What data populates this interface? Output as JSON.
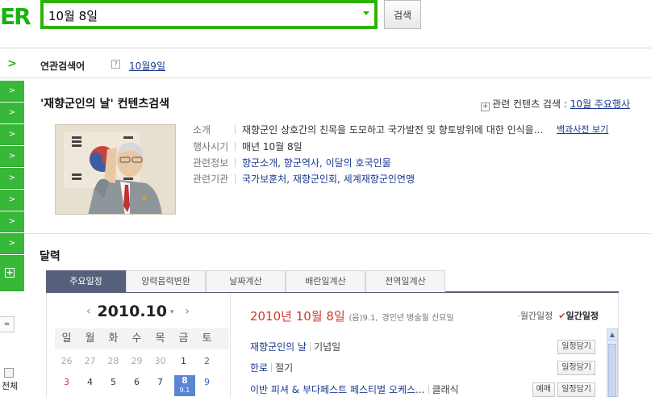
{
  "header": {
    "logo_text": "ER",
    "search_value": "10월 8일",
    "search_button": "검색"
  },
  "sidebar": {
    "top_arrow": ">",
    "items": [
      ">",
      ">",
      ">",
      ">",
      ">",
      ">",
      ">",
      ">"
    ],
    "plus": "+",
    "small_box": "=",
    "all_label": "전체"
  },
  "related": {
    "label": "연관검색어",
    "help": "?",
    "link": "10월9일"
  },
  "content_search": {
    "title": "'재향군인의 날' 컨텐츠검색",
    "related_prefix_icon": "+",
    "related_label": "관련 컨텐츠 검색 :",
    "related_link": "10월 주요행사",
    "rows": [
      {
        "key": "소개",
        "value": "재향군인 상호간의 친목을 도모하고 국가발전 및 향토방위에 대한 인식을..."
      },
      {
        "key": "행사시기",
        "value": "매년 10월 8일"
      },
      {
        "key": "관련정보",
        "value": "향군소개, 향군역사, 이달의 호국인물"
      },
      {
        "key": "관련기관",
        "value": "국가보훈처, 재향군인회, 세계재향군인연맹"
      }
    ],
    "dict_link": "백과사전 보기"
  },
  "calendar": {
    "title": "달력",
    "tabs": [
      "주요일정",
      "양력음력변환",
      "날짜계산",
      "배란일계산",
      "전역일계산"
    ],
    "month_label": "2010.10",
    "prev_arrow": "‹",
    "next_arrow": "›",
    "caret": "▾",
    "weekdays": [
      "일",
      "월",
      "화",
      "수",
      "목",
      "금",
      "토"
    ],
    "week1": [
      "26",
      "27",
      "28",
      "29",
      "30",
      "1",
      "2"
    ],
    "week2": [
      "3",
      "4",
      "5",
      "6",
      "7",
      "8",
      "9"
    ],
    "today_lunar": "9.1",
    "selected_date": "2010년 10월 8일",
    "selected_lunar": "(음)9.1,",
    "selected_ganji": "경인년 병술월 신묘일",
    "view_monthly": "월간일정",
    "view_daily": "일간일정",
    "events": [
      {
        "name": "재향군인의 날",
        "type": "기념일",
        "buttons": [
          "일정담기"
        ]
      },
      {
        "name": "한로",
        "type": "절기",
        "buttons": [
          "일정담기"
        ]
      },
      {
        "name": "이반 피셔 & 부다페스트 페스티벌 오케스...",
        "type": "클래식",
        "buttons": [
          "예매",
          "일정담기"
        ]
      }
    ]
  }
}
